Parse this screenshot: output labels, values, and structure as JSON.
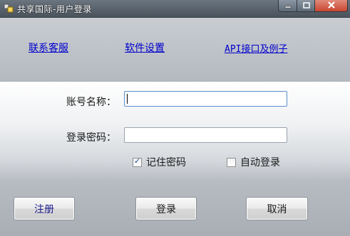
{
  "window": {
    "title": "共享国际-用户登录"
  },
  "links": {
    "customer_service": "联系客服",
    "software_settings": "软件设置",
    "api_examples": "API接口及例子"
  },
  "form": {
    "account_label": "账号名称：",
    "account_value": "",
    "password_label": "登录密码：",
    "password_value": "",
    "remember_password": {
      "label": "记住密码",
      "checked": true
    },
    "auto_login": {
      "label": "自动登录",
      "checked": false
    }
  },
  "buttons": {
    "register": "注册",
    "login": "登录",
    "cancel": "取消"
  },
  "colors": {
    "link": "#0000cc",
    "titlebar": "#4a535c",
    "close_button": "#c8452f"
  },
  "icons": {
    "app": "app-icon",
    "minimize": "minimize-icon",
    "maximize": "maximize-icon",
    "close": "close-icon",
    "check": "check-icon"
  }
}
